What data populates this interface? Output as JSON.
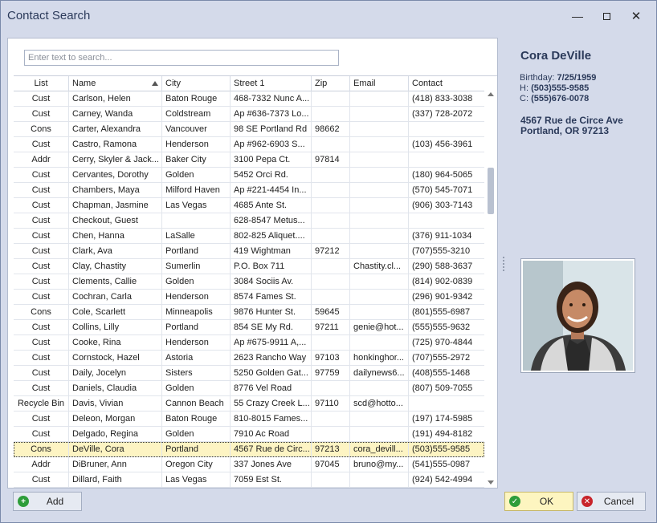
{
  "window": {
    "title": "Contact Search"
  },
  "search": {
    "placeholder": "Enter text to search..."
  },
  "grid": {
    "columns": [
      "List",
      "Name",
      "City",
      "Street 1",
      "Zip",
      "Email",
      "Contact"
    ],
    "sorted_column": "Name",
    "rows": [
      [
        "Cust",
        "Carlson, Helen",
        "Baton Rouge",
        "468-7332 Nunc A...",
        "",
        "",
        "(418) 833-3038"
      ],
      [
        "Cust",
        "Carney, Wanda",
        "Coldstream",
        "Ap #636-7373 Lo...",
        "",
        "",
        "(337) 728-2072"
      ],
      [
        "Cons",
        "Carter, Alexandra",
        "Vancouver",
        "98 SE Portland Rd",
        "98662",
        "",
        ""
      ],
      [
        "Cust",
        "Castro, Ramona",
        "Henderson",
        "Ap #962-6903 S...",
        "",
        "",
        "(103) 456-3961"
      ],
      [
        "Addr",
        "Cerry, Skyler & Jack...",
        "Baker City",
        "3100 Pepa Ct.",
        "97814",
        "",
        ""
      ],
      [
        "Cust",
        "Cervantes, Dorothy",
        "Golden",
        "5452 Orci Rd.",
        "",
        "",
        "(180) 964-5065"
      ],
      [
        "Cust",
        "Chambers, Maya",
        "Milford Haven",
        "Ap #221-4454 In...",
        "",
        "",
        "(570) 545-7071"
      ],
      [
        "Cust",
        "Chapman, Jasmine",
        "Las Vegas",
        "4685 Ante St.",
        "",
        "",
        "(906) 303-7143"
      ],
      [
        "Cust",
        "Checkout, Guest",
        "",
        "628-8547 Metus...",
        "",
        "",
        ""
      ],
      [
        "Cust",
        "Chen, Hanna",
        "LaSalle",
        "802-825 Aliquet....",
        "",
        "",
        "(376) 911-1034"
      ],
      [
        "Cust",
        "Clark, Ava",
        "Portland",
        "419 Wightman",
        "97212",
        "",
        "(707)555-3210"
      ],
      [
        "Cust",
        "Clay, Chastity",
        "Sumerlin",
        "P.O. Box 711",
        "",
        "Chastity.cl...",
        "(290) 588-3637"
      ],
      [
        "Cust",
        "Clements, Callie",
        "Golden",
        "3084 Sociis Av.",
        "",
        "",
        "(814) 902-0839"
      ],
      [
        "Cust",
        "Cochran, Carla",
        "Henderson",
        "8574 Fames St.",
        "",
        "",
        "(296) 901-9342"
      ],
      [
        "Cons",
        "Cole, Scarlett",
        "Minneapolis",
        "9876 Hunter St.",
        "59645",
        "",
        "(801)555-6987"
      ],
      [
        "Cust",
        "Collins, Lilly",
        "Portland",
        "854 SE My Rd.",
        "97211",
        "genie@hot...",
        "(555)555-9632"
      ],
      [
        "Cust",
        "Cooke, Rina",
        "Henderson",
        "Ap #675-9911 A,...",
        "",
        "",
        "(725) 970-4844"
      ],
      [
        "Cust",
        "Cornstock, Hazel",
        "Astoria",
        "2623 Rancho Way",
        "97103",
        "honkinghor...",
        "(707)555-2972"
      ],
      [
        "Cust",
        "Daily, Jocelyn",
        "Sisters",
        "5250 Golden Gat...",
        "97759",
        "dailynews6...",
        "(408)555-1468"
      ],
      [
        "Cust",
        "Daniels, Claudia",
        "Golden",
        "8776 Vel Road",
        "",
        "",
        "(807) 509-7055"
      ],
      [
        "Recycle Bin",
        "Davis, Vivian",
        "Cannon Beach",
        "55 Crazy Creek L...",
        "97110",
        "scd@hotto...",
        ""
      ],
      [
        "Cust",
        "Deleon, Morgan",
        "Baton Rouge",
        "810-8015 Fames...",
        "",
        "",
        "(197) 174-5985"
      ],
      [
        "Cust",
        "Delgado, Regina",
        "Golden",
        "7910 Ac Road",
        "",
        "",
        "(191) 494-8182"
      ],
      [
        "Cons",
        "DeVille, Cora",
        "Portland",
        "4567 Rue de Circ...",
        "97213",
        "cora_devill...",
        "(503)555-9585"
      ],
      [
        "Addr",
        "DiBruner, Ann",
        "Oregon City",
        "337 Jones Ave",
        "97045",
        "bruno@my...",
        "(541)555-0987"
      ],
      [
        "Cust",
        "Dillard, Faith",
        "Las Vegas",
        "7059 Est St.",
        "",
        "",
        "(924) 542-4994"
      ]
    ],
    "selected_index": 23
  },
  "detail": {
    "name": "Cora DeVille",
    "birthday_label": "Birthday:",
    "birthday": "7/25/1959",
    "home_label": "H:",
    "home": "(503)555-9585",
    "cell_label": "C:",
    "cell": "(555)676-0078",
    "address1": "4567 Rue de Circe Ave",
    "address2": "Portland, OR  97213"
  },
  "buttons": {
    "add": "Add",
    "ok": "OK",
    "cancel": "Cancel"
  },
  "colors": {
    "selected_row": "#fdf4c3",
    "ok_button": "#fdf5c0",
    "add_icon": "#2e9d3a",
    "ok_icon": "#2e9d3a",
    "cancel_icon": "#c8242b"
  },
  "icons": {
    "add": "plus-circle-icon",
    "ok": "check-circle-icon",
    "cancel": "x-circle-icon",
    "sort": "sort-ascending-icon"
  }
}
